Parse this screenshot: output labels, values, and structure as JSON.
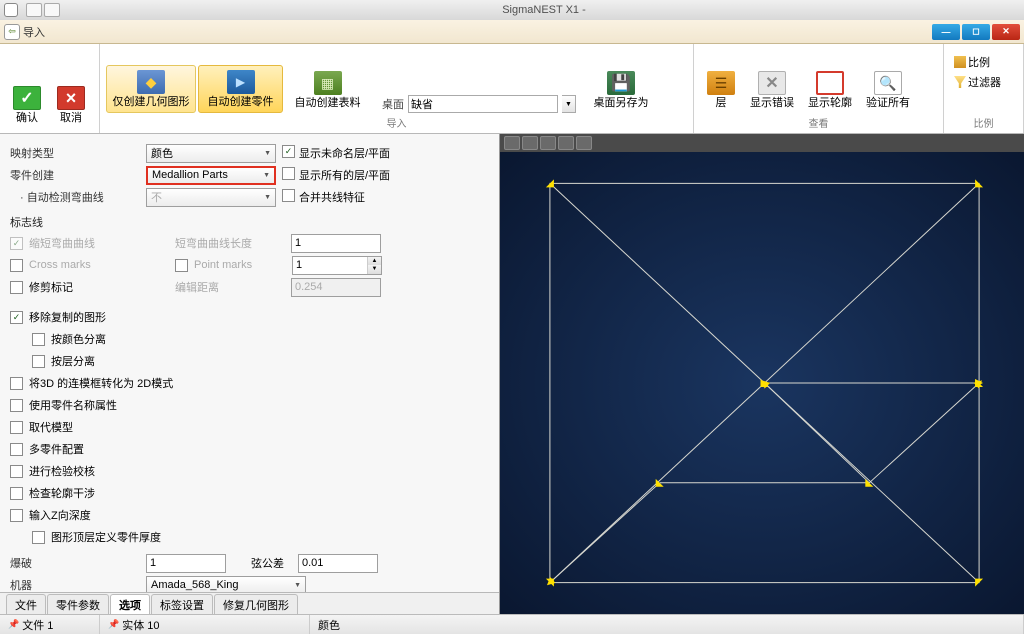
{
  "app": {
    "title": "SigmaNEST X1 -"
  },
  "dialog": {
    "title": "导入"
  },
  "ribbon": {
    "confirm": "确认",
    "cancel": "取消",
    "create_geometry_only": "仅创建几何图形",
    "auto_create_parts": "自动创建零件",
    "auto_create_material": "自动创建表料",
    "desktop_label": "桌面",
    "desktop_value": "缺省",
    "save_desktop_as": "桌面另存为",
    "layer": "层",
    "show_errors": "显示错误",
    "show_contours": "显示轮廓",
    "validate_all": "验证所有",
    "ratio": "比例",
    "filter": "过滤器",
    "group_import": "导入",
    "group_view": "查看",
    "group_ratio": "比例"
  },
  "options": {
    "mapping_type_label": "映射类型",
    "mapping_type_value": "颜色",
    "part_creation_label": "零件创建",
    "part_creation_value": "Medallion Parts",
    "auto_detect_bend_label": "自动检测弯曲线",
    "auto_detect_bend_value": "不",
    "mark_lines_label": "标志线",
    "shorten_bend_lines_label": "缩短弯曲曲线",
    "shorten_bend_length_label": "短弯曲曲线长度",
    "shorten_bend_length_value": "1",
    "cross_marks_label": "Cross marks",
    "point_marks_label": "Point marks",
    "point_marks_value": "1",
    "trim_marks_label": "修剪标记",
    "mark_distance_label": "编辑距离",
    "mark_distance_value": "0.254",
    "remove_duplicate_label": "移除复制的图形",
    "separate_by_color_label": "按颜色分离",
    "separate_by_layer_label": "按层分离",
    "convert_3d_label": "将3D 的连模框转化为 2D模式",
    "use_part_name_attr_label": "使用零件名称属性",
    "replace_model_label": "取代模型",
    "multi_part_config_label": "多零件配置",
    "do_inspection_label": "进行检验校核",
    "check_contour_interfere_label": "检查轮廓干涉",
    "input_z_depth_label": "输入Z向深度",
    "graphic_top_define_thickness_label": "图形顶层定义零件厚度",
    "explosion_label": "爆破",
    "explosion_value": "1",
    "tolerance_label": "弦公差",
    "tolerance_value": "0.01",
    "machine_label": "机器",
    "machine_value": "Amada_568_King"
  },
  "checks": {
    "show_unnamed_layer": "显示未命名层/平面",
    "show_all_layers": "显示所有的层/平面",
    "merge_colinear": "合并共线特征"
  },
  "tabs": {
    "file": "文件",
    "part_params": "零件参数",
    "options": "选项",
    "label_settings": "标签设置",
    "fix_geometry": "修复几何图形"
  },
  "status": {
    "file_count": "文件 1",
    "entities": "实体 10",
    "color": "颜色"
  }
}
